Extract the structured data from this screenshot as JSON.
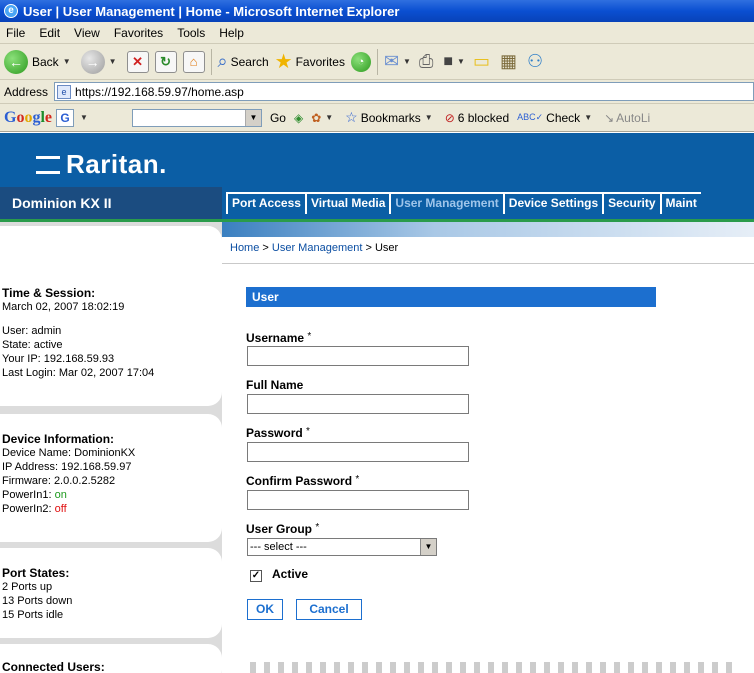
{
  "window": {
    "title": "User | User Management | Home - Microsoft Internet Explorer"
  },
  "menubar": [
    "File",
    "Edit",
    "View",
    "Favorites",
    "Tools",
    "Help"
  ],
  "toolbar": {
    "back": "Back",
    "search": "Search",
    "favorites": "Favorites"
  },
  "address": {
    "label": "Address",
    "url": "https://192.168.59.97/home.asp"
  },
  "googlebar": {
    "go": "Go",
    "bookmarks": "Bookmarks",
    "blocked": "6 blocked",
    "check": "Check",
    "autolink": "AutoLi"
  },
  "brand": {
    "logo": "Raritan.",
    "product": "Dominion KX II"
  },
  "tabs": [
    "Port Access",
    "Virtual Media",
    "User Management",
    "Device Settings",
    "Security",
    "Maint"
  ],
  "breadcrumb": {
    "home": "Home",
    "section": "User Management",
    "current": "User",
    "sep": ">"
  },
  "session": {
    "heading": "Time & Session:",
    "datetime": "March 02, 2007 18:02:19",
    "user": "User: admin",
    "state": "State: active",
    "ip": "Your IP: 192.168.59.93",
    "last_login": "Last Login: Mar 02, 2007 17:04"
  },
  "device": {
    "heading": "Device Information:",
    "name": "Device Name: DominionKX",
    "ip": "IP Address: 192.168.59.97",
    "firmware": "Firmware: 2.0.0.2.5282",
    "powerin1_label": "PowerIn1:",
    "powerin1_value": "on",
    "powerin2_label": "PowerIn2:",
    "powerin2_value": "off"
  },
  "ports": {
    "heading": "Port States:",
    "up": "2 Ports up",
    "down": "13 Ports down",
    "idle": "15 Ports idle"
  },
  "connected": {
    "heading": "Connected Users:"
  },
  "form": {
    "section_title": "User",
    "username_label": "Username",
    "fullname_label": "Full Name",
    "password_label": "Password",
    "confirm_label": "Confirm Password",
    "group_label": "User Group",
    "required_mark": "*",
    "group_value": "--- select ---",
    "active_label": "Active",
    "ok_label": "OK",
    "cancel_label": "Cancel"
  },
  "colors": {
    "brand_blue": "#0b5ea5",
    "section_blue": "#1c6fcf",
    "power_on": "#1e9a1e",
    "power_off": "#e01010"
  }
}
